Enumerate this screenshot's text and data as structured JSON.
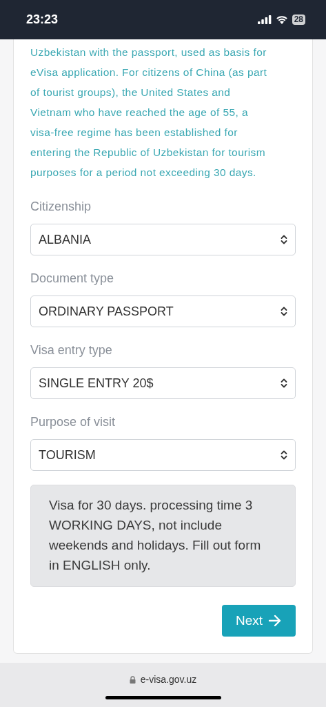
{
  "status_bar": {
    "time": "23:23",
    "battery": "28"
  },
  "notice": "Uzbekistan with the passport, used as basis for eVisa application. For citizens of China (as part of tourist groups), the United States and Vietnam who have reached the age of 55, a visa-free regime has been established for entering the Republic of Uzbekistan for tourism purposes for a period not exceeding 30 days.",
  "fields": [
    {
      "label": "Citizenship",
      "value": "ALBANIA"
    },
    {
      "label": "Document type",
      "value": "ORDINARY PASSPORT"
    },
    {
      "label": "Visa entry type",
      "value": "SINGLE ENTRY 20$"
    },
    {
      "label": "Purpose of visit",
      "value": "TOURISM"
    }
  ],
  "info": "Visa for 30 days. processing time 3 WORKING DAYS, not include weekends and holidays. Fill out form in ENGLISH only.",
  "next_button": "Next",
  "address_bar": {
    "url": "e-visa.gov.uz"
  }
}
